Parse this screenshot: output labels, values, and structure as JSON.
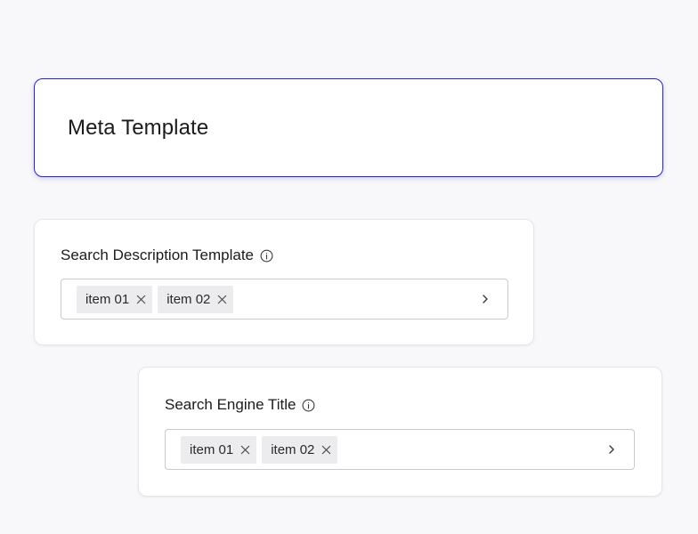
{
  "header": {
    "title": "Meta Template"
  },
  "fields": [
    {
      "label": "Search Description Template",
      "icon": "info-icon",
      "tags": [
        {
          "label": "item 01",
          "remove_icon": "close-icon"
        },
        {
          "label": "item 02",
          "remove_icon": "close-icon"
        }
      ],
      "expand_icon": "chevron-right-icon"
    },
    {
      "label": "Search Engine Title",
      "icon": "info-icon",
      "tags": [
        {
          "label": "item 01",
          "remove_icon": "close-icon"
        },
        {
          "label": "item 02",
          "remove_icon": "close-icon"
        }
      ],
      "expand_icon": "chevron-right-icon"
    }
  ],
  "colors": {
    "accent": "#2424c8",
    "background": "#f8f8fa",
    "tag_background": "#ececef"
  }
}
